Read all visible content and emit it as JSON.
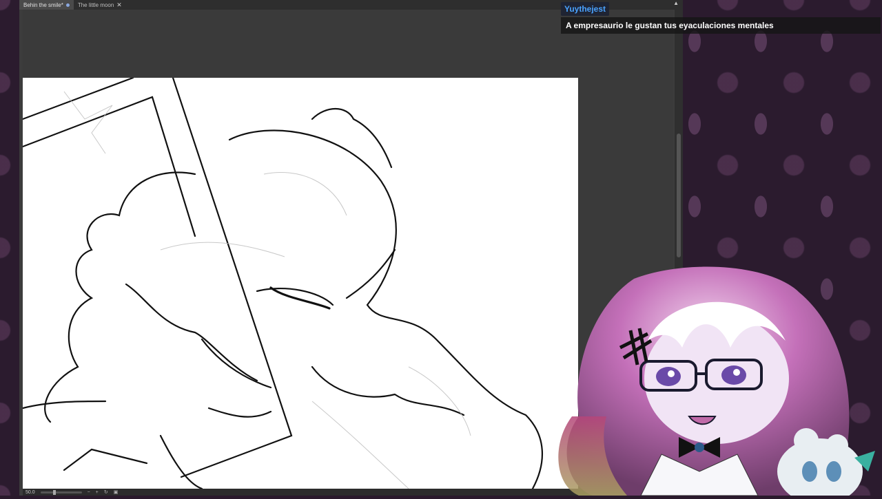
{
  "tabs": [
    {
      "label": "Behin the smile*",
      "active": true
    },
    {
      "label": "The little moon",
      "active": false
    }
  ],
  "status": {
    "zoom": "50.0"
  },
  "chat": {
    "username": "Yuythejest",
    "message": "A empresaurio le gustan tus eyaculaciones mentales"
  },
  "colors": {
    "username": "#4aa3ff",
    "canvas": "#ffffff",
    "wallpaper": "#2b1b2e"
  }
}
